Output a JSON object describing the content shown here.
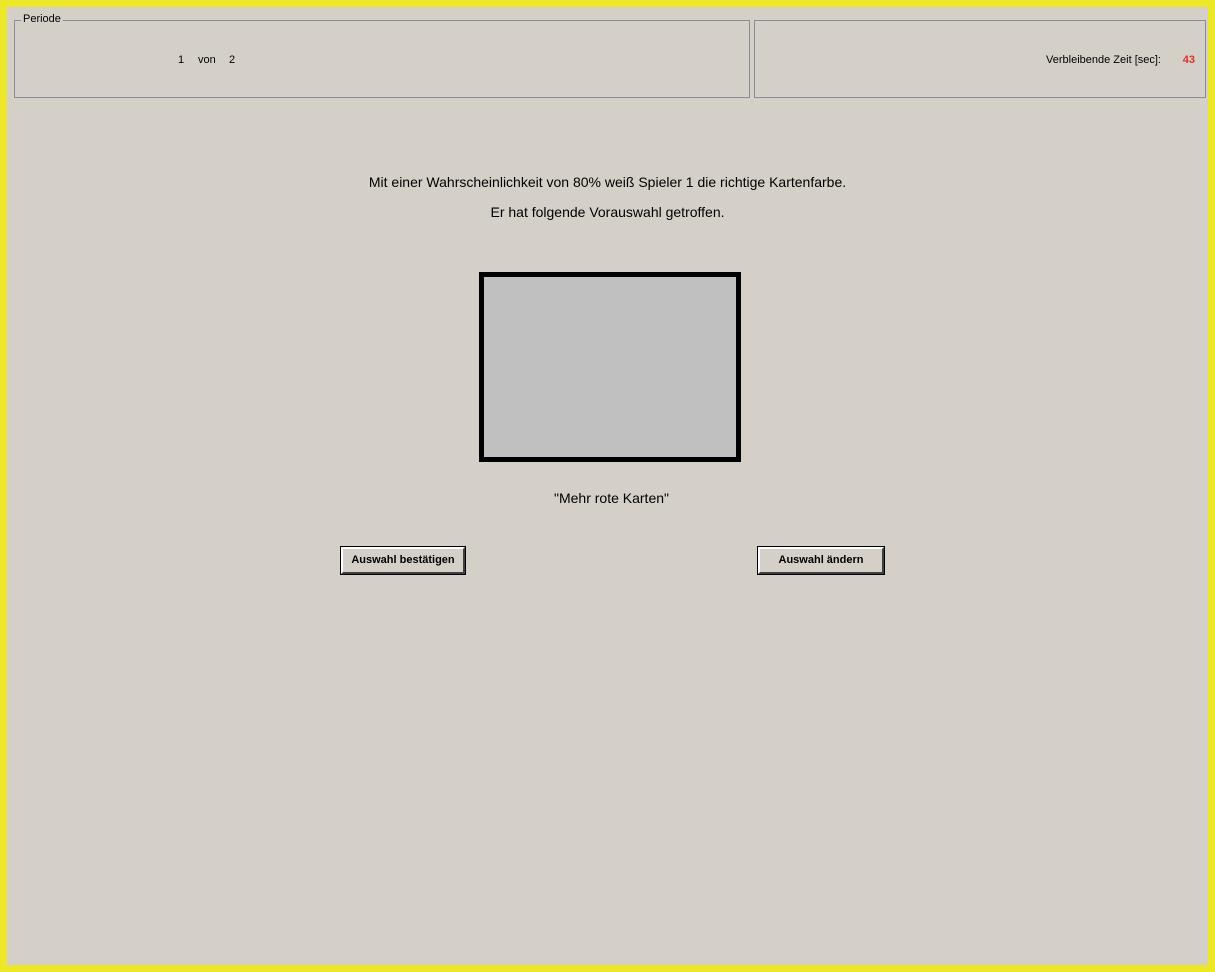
{
  "period": {
    "legend": "Periode",
    "current": "1",
    "of_label": "von",
    "total": "2"
  },
  "timer": {
    "label": "Verbleibende Zeit [sec]:",
    "value": "43",
    "value_color": "#e03030"
  },
  "info": {
    "line1": "Mit einer Wahrscheinlichkeit von 80% weiß Spieler 1 die richtige Kartenfarbe.",
    "line2": "Er hat folgende Vorauswahl getroffen."
  },
  "card": {
    "fill_color": "#c0c0c0",
    "border_color": "#000000"
  },
  "choice": {
    "caption": "\"Mehr rote Karten\""
  },
  "buttons": {
    "confirm_label": "Auswahl bestätigen",
    "change_label": "Auswahl ändern"
  },
  "colors": {
    "window_border": "#ede72a",
    "background": "#d4d0c8"
  }
}
